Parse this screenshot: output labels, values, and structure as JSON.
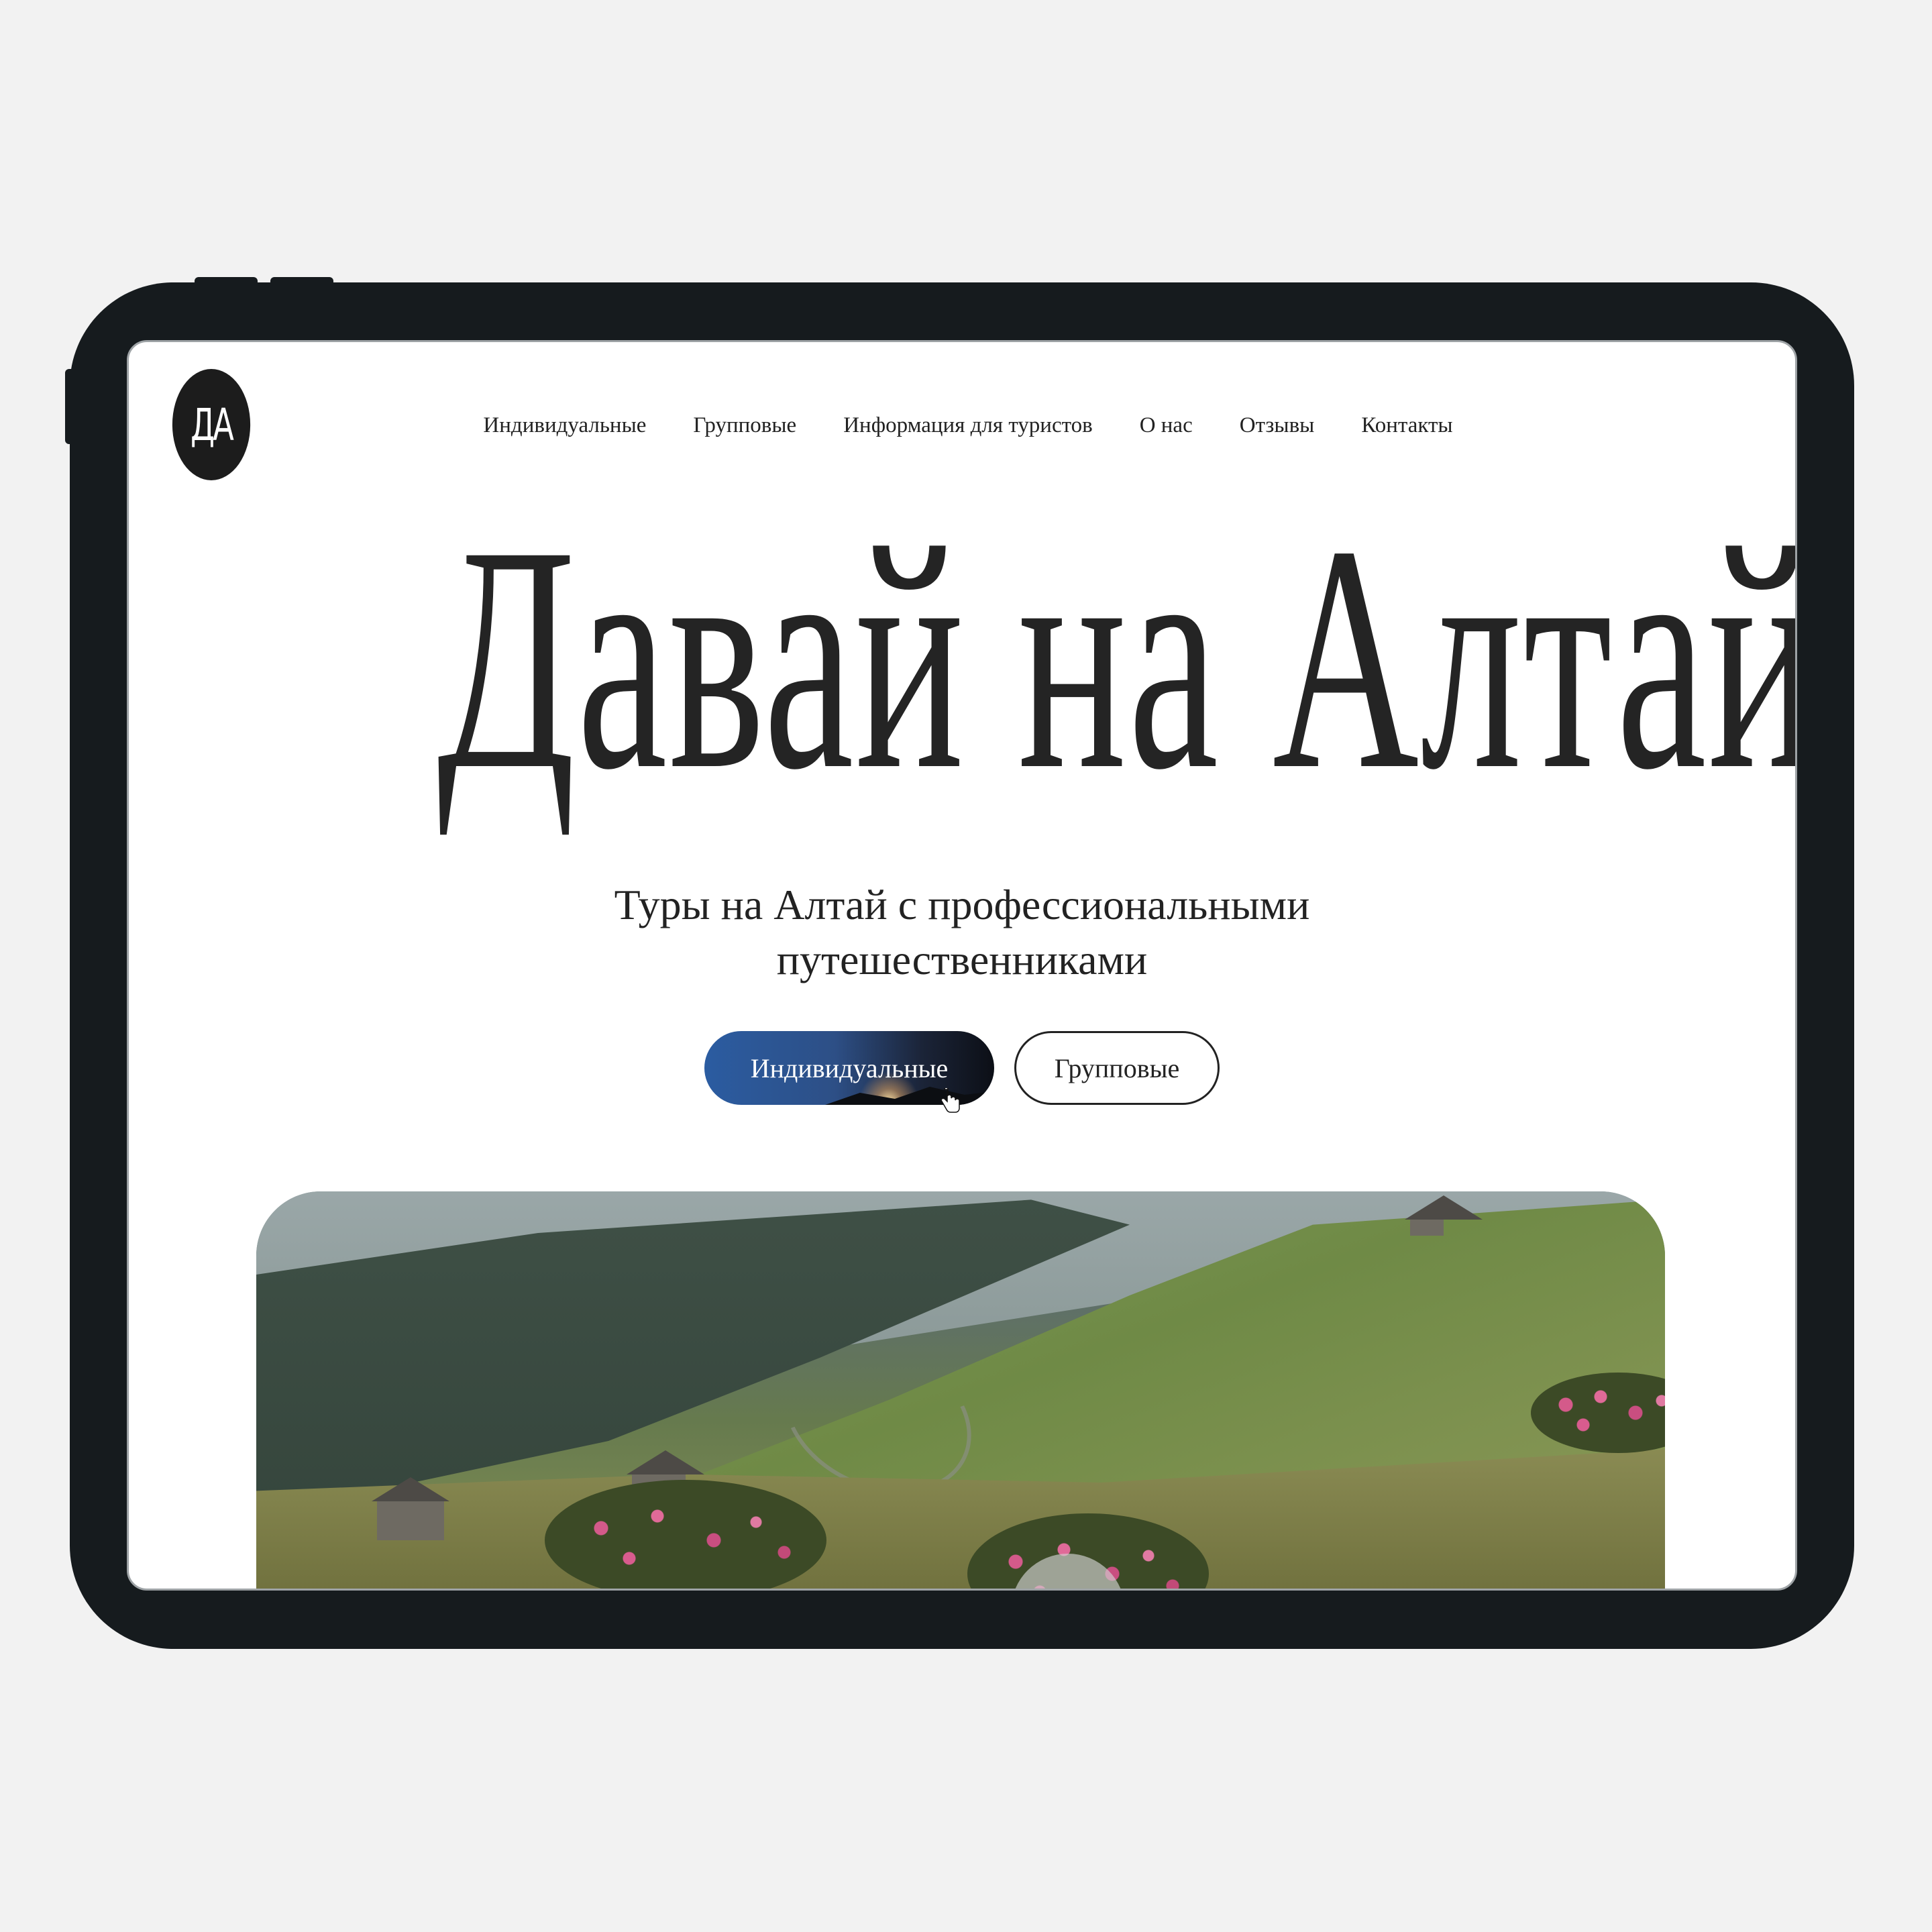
{
  "brand": {
    "logo_text": "ДА"
  },
  "nav": {
    "items": [
      {
        "label": "Индивидуальные"
      },
      {
        "label": "Групповые"
      },
      {
        "label": "Информация для туристов"
      },
      {
        "label": "О нас"
      },
      {
        "label": "Отзывы"
      },
      {
        "label": "Контакты"
      }
    ]
  },
  "hero": {
    "headline": "Давай на Алтай",
    "subtitle_line1": "Туры на Алтай с профессиональными",
    "subtitle_line2": "путешественниками",
    "primary_button": "Индивидуальные",
    "secondary_button": "Групповые"
  },
  "media": {
    "photo_icon": "mountain-meadow-photo",
    "control_icon": "pause-icon"
  },
  "colors": {
    "page_bg": "#f2f2f2",
    "device_frame": "#161b1e",
    "text": "#222222",
    "primary_button_start": "#2b5ca1",
    "primary_button_end": "#0c0f16"
  }
}
